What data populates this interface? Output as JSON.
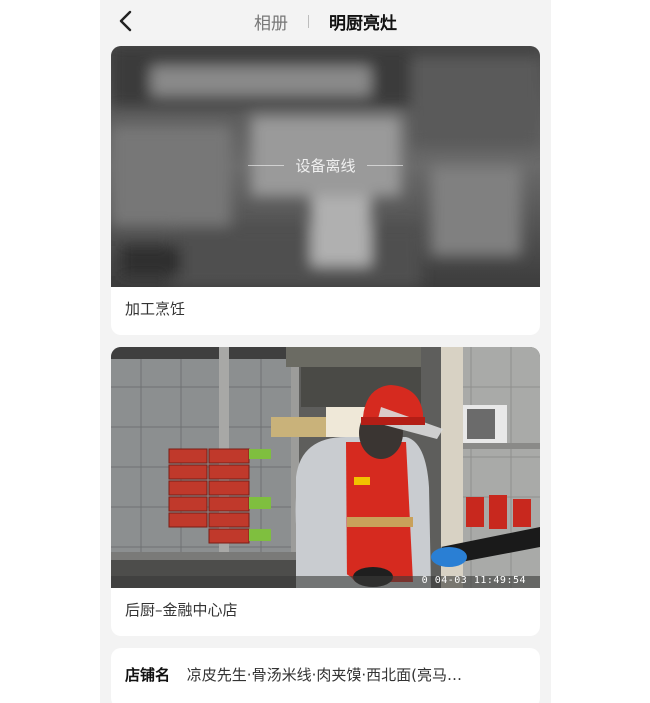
{
  "nav": {
    "back_icon": "chevron-left-icon",
    "tabs": [
      {
        "label": "相册",
        "active": false
      },
      {
        "label": "明厨亮灶",
        "active": true
      }
    ]
  },
  "cameras": [
    {
      "status": "设备离线",
      "name": "加工烹饪",
      "online": false
    },
    {
      "timestamp": "0 04-03 11:49:54",
      "name": "后厨–金融中心店",
      "online": true
    }
  ],
  "store_info": {
    "label": "店铺名",
    "value": "凉皮先生·骨汤米线·肉夹馍·西北面(亮马…"
  },
  "colors": {
    "background": "#f3f3f3",
    "card": "#ffffff",
    "uniform_red": "#d62a1f",
    "glove_blue": "#2a7fd4"
  }
}
